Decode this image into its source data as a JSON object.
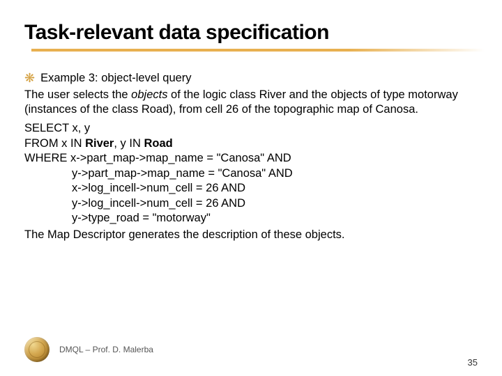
{
  "title": "Task-relevant data specification",
  "bullet_glyph": "❋",
  "example_label": "Example 3: object-level query",
  "desc_pre": "The user selects the ",
  "desc_objects": "objects",
  "desc_post": " of the logic class River and the objects of type motorway (instances of the class Road), from cell 26 of the topographic map of Canosa.",
  "query": {
    "select": "SELECT x, y",
    "from_pre": "FROM x IN ",
    "from_river": "River",
    "from_mid": ", y IN ",
    "from_road": "Road",
    "where": "WHERE x->part_map->map_name = \"Canosa\" AND",
    "l2": "y->part_map->map_name = \"Canosa\" AND",
    "l3": "x->log_incell->num_cell = 26 AND",
    "l4": "y->log_incell->num_cell = 26 AND",
    "l5": "y->type_road = \"motorway\""
  },
  "closing": "The Map Descriptor generates the description of these objects.",
  "footer": "DMQL – Prof. D. Malerba",
  "page": "35"
}
